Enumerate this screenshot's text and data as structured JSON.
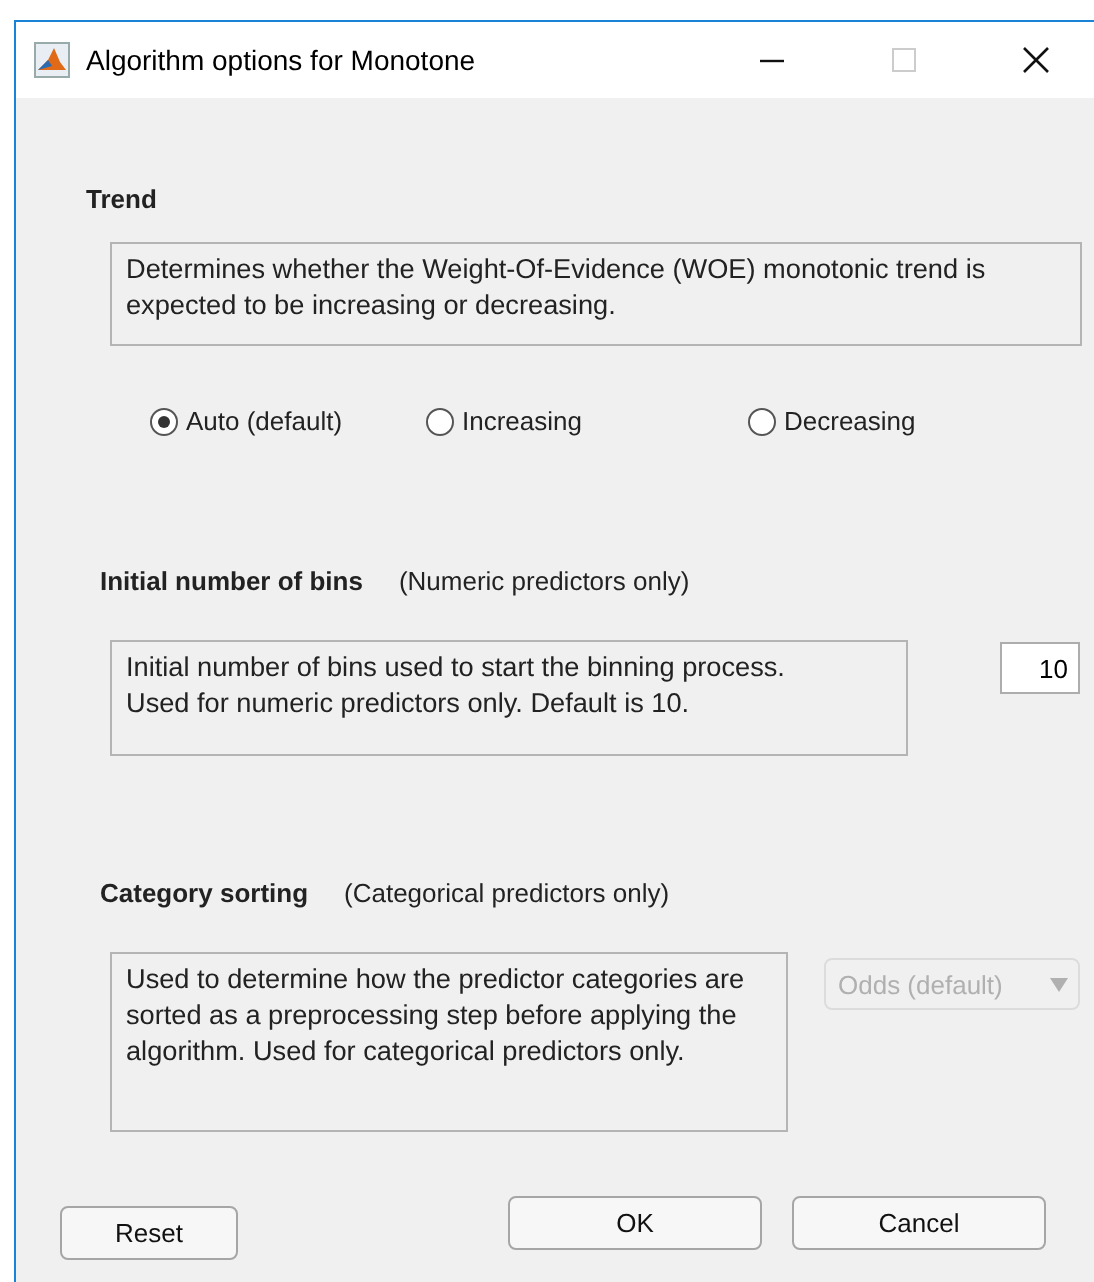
{
  "window": {
    "title": "Algorithm options for Monotone"
  },
  "trend": {
    "title": "Trend",
    "description": "Determines whether the Weight-Of-Evidence (WOE) monotonic trend is expected to be increasing or decreasing.",
    "options": [
      {
        "label": "Auto (default)",
        "selected": true
      },
      {
        "label": "Increasing",
        "selected": false
      },
      {
        "label": "Decreasing",
        "selected": false
      }
    ]
  },
  "bins": {
    "title": "Initial number of bins",
    "subtitle": "(Numeric predictors only)",
    "description": "Initial number of bins used to start the binning process.\n Used for numeric predictors only. Default is 10.",
    "value": "10"
  },
  "sorting": {
    "title": "Category sorting",
    "subtitle": "(Categorical predictors only)",
    "description": "Used to determine how the predictor categories are sorted as a preprocessing step before applying the algorithm. Used for categorical predictors only.",
    "value": "Odds (default)",
    "disabled": true
  },
  "buttons": {
    "reset": "Reset",
    "ok": "OK",
    "cancel": "Cancel"
  }
}
